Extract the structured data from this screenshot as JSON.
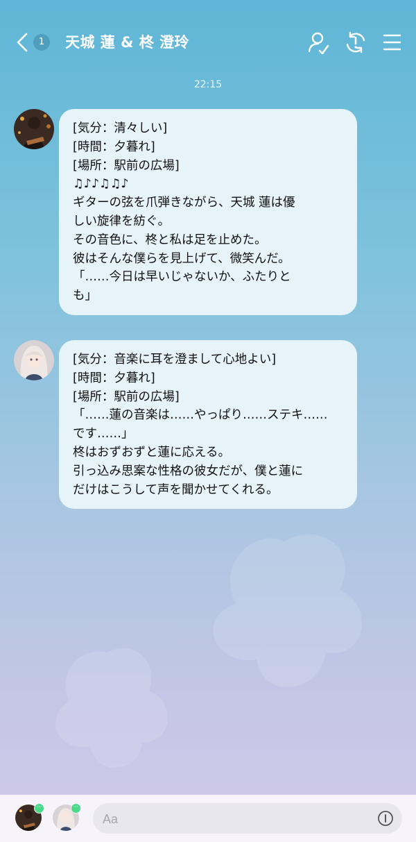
{
  "header": {
    "back_count": "1",
    "title": "天城 蓮 & 柊 澄玲"
  },
  "timestamp": "22:15",
  "messages": [
    {
      "sender": "天城 蓮",
      "lines": [
        "[気分：清々しい]",
        "[時間：夕暮れ]",
        "[場所：駅前の広場]",
        "♫♪♪♫♫♪",
        "ギターの弦を爪弾きながら、天城 蓮は優",
        "しい旋律を紡ぐ。",
        "その音色に、柊と私は足を止めた。",
        "彼はそんな僕らを見上げて、微笑んだ。",
        "「……今日は早いじゃないか、ふたりと",
        "も」"
      ]
    },
    {
      "sender": "柊 澄玲",
      "lines": [
        "[気分：音楽に耳を澄まして心地よい]",
        "[時間：夕暮れ]",
        "[場所：駅前の広場]",
        "「……蓮の音楽は……やっぱり……ステキ……",
        "です……」",
        "柊はおずおずと蓮に応える。",
        "引っ込み思案な性格の彼女だが、僕と蓮に",
        "だけはこうして声を聞かせてくれる。"
      ]
    }
  ],
  "footer": {
    "input_placeholder": "Aa",
    "badge_1": "···",
    "badge_2": "···"
  }
}
